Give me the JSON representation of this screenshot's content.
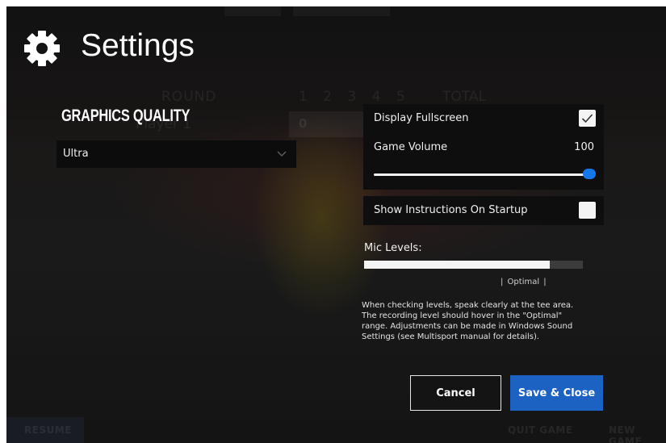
{
  "header": {
    "title": "Settings",
    "icon": "gear-icon"
  },
  "background": {
    "round_label": "ROUND",
    "round_numbers": "1  2  3  4  5",
    "total_label": "TOTAL",
    "player_label": "Player 1",
    "player_score": "0",
    "resume_label": "RESUME",
    "quit_label": "QUIT GAME",
    "new_game_label": "NEW GAME"
  },
  "graphics": {
    "label": "GRAPHICS QUALITY",
    "selected": "Ultra"
  },
  "settings": {
    "fullscreen_label": "Display Fullscreen",
    "fullscreen_checked": true,
    "volume_label": "Game Volume",
    "volume_value": "100",
    "volume_level": 1.0,
    "instructions_label": "Show Instructions On Startup",
    "instructions_checked": false
  },
  "mic": {
    "label": "Mic Levels:",
    "level": 0.85,
    "optimal_label": "| Optimal |",
    "help_text": "When checking levels, speak clearly at the tee area. The recording level should hover in the \"Optimal\" range. Adjustments can be made in Windows Sound Settings (see Multisport manual for details)."
  },
  "buttons": {
    "cancel": "Cancel",
    "save": "Save & Close"
  },
  "colors": {
    "accent": "#1c62c2",
    "slider_thumb": "#1677ea"
  }
}
